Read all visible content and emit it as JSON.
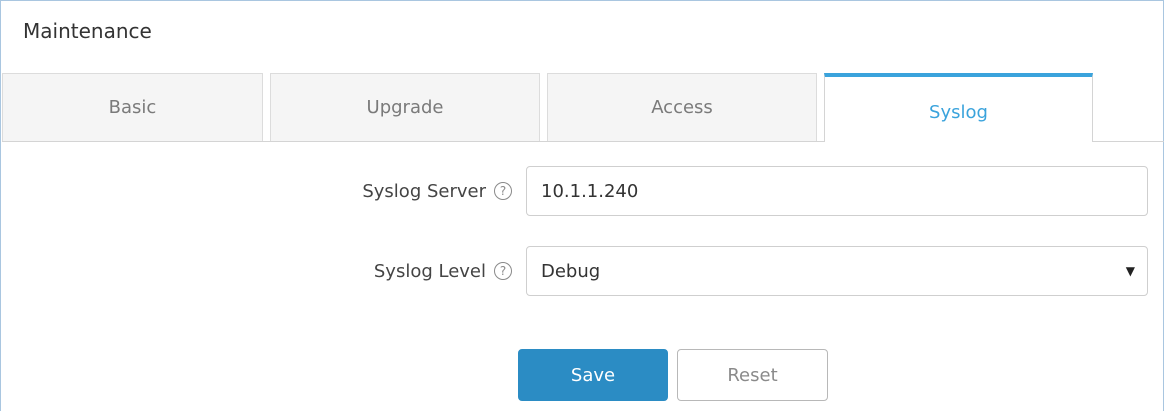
{
  "page": {
    "title": "Maintenance"
  },
  "tabs": [
    {
      "label": "Basic",
      "active": false
    },
    {
      "label": "Upgrade",
      "active": false
    },
    {
      "label": "Access",
      "active": false
    },
    {
      "label": "Syslog",
      "active": true
    }
  ],
  "form": {
    "syslog_server": {
      "label": "Syslog Server",
      "value": "10.1.1.240",
      "help_icon": "help-circle-icon"
    },
    "syslog_level": {
      "label": "Syslog Level",
      "value": "Debug",
      "help_icon": "help-circle-icon",
      "caret_icon": "caret-down-icon"
    }
  },
  "actions": {
    "save_label": "Save",
    "reset_label": "Reset"
  },
  "colors": {
    "accent": "#3aa3dc",
    "save_button": "#2b8cc4",
    "frame_border": "#a9c6e0"
  }
}
